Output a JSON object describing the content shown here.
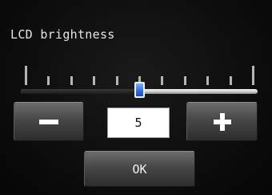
{
  "title": "LCD brightness",
  "brightness": {
    "value": "5",
    "slider_fraction": 0.5,
    "tick_count": 11
  },
  "buttons": {
    "decrease_icon": "minus-icon",
    "increase_icon": "plus-icon",
    "ok_label": "OK"
  },
  "colors": {
    "background": "#0b0b0b",
    "button": "#474747",
    "slider_thumb": "#2f6fe0",
    "value_box": "#ffffff"
  }
}
